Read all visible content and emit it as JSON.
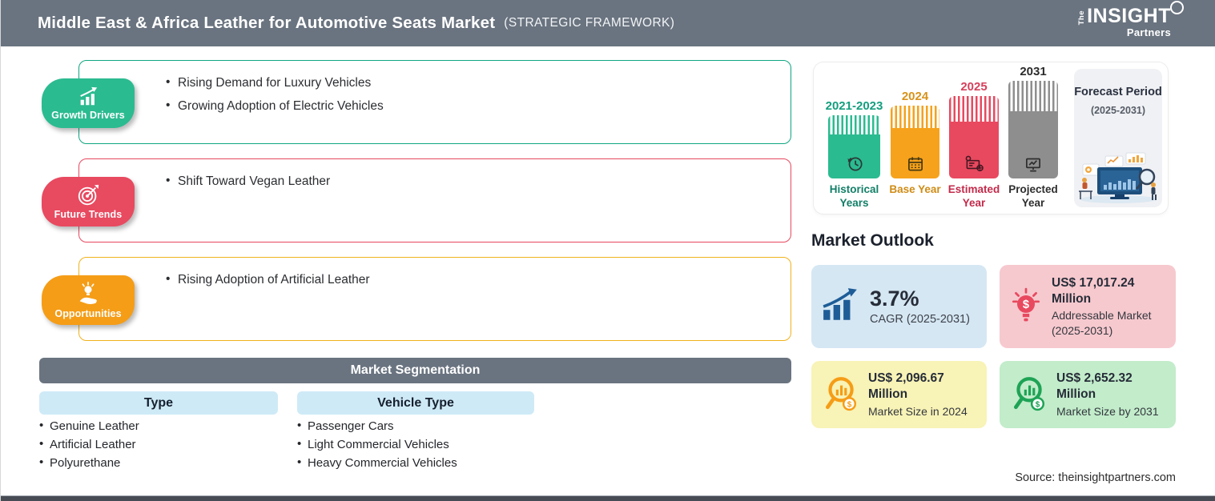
{
  "header": {
    "title": "Middle East & Africa Leather for Automotive Seats Market",
    "framework_tag": "(STRATEGIC FRAMEWORK)",
    "logo": {
      "the": "The",
      "insight": "INSIGHT",
      "partners": "Partners"
    }
  },
  "panels": {
    "growth_drivers": {
      "label": "Growth Drivers",
      "accent_color": "#2bbb90",
      "items": [
        "Rising Demand for Luxury Vehicles",
        "Growing Adoption of Electric Vehicles"
      ]
    },
    "future_trends": {
      "label": "Future Trends",
      "accent_color": "#e84a60",
      "items": [
        "Shift Toward Vegan Leather"
      ]
    },
    "opportunities": {
      "label": "Opportunities",
      "accent_color": "#f59d17",
      "items": [
        "Rising Adoption of Artificial Leather"
      ]
    }
  },
  "segmentation": {
    "title": "Market Segmentation",
    "columns": [
      {
        "header": "Type",
        "items": [
          "Genuine Leather",
          "Artificial Leather",
          "Polyurethane"
        ]
      },
      {
        "header": "Vehicle Type",
        "items": [
          "Passenger Cars",
          "Light Commercial Vehicles",
          "Heavy Commercial Vehicles"
        ]
      }
    ]
  },
  "timeline": {
    "bars": [
      {
        "year": "2021-2023",
        "label": "Historical Years",
        "color": "#2bbb90",
        "icon": "clock-history-icon"
      },
      {
        "year": "2024",
        "label": "Base Year",
        "color": "#f6a21c",
        "icon": "calendar-icon"
      },
      {
        "year": "2025",
        "label": "Estimated Year",
        "color": "#e8495f",
        "icon": "estimate-document-icon"
      },
      {
        "year": "2031",
        "label": "Projected Year",
        "color": "#8e8e8e",
        "icon": "projection-board-icon"
      }
    ],
    "forecast_period": {
      "title": "Forecast Period",
      "range": "(2025-2031)"
    }
  },
  "outlook": {
    "title": "Market Outlook",
    "cards": [
      {
        "value": "3.7%",
        "label": "CAGR (2025-2031)",
        "bg_color": "#d5e7f3",
        "icon": "growth-bars-arrow-icon"
      },
      {
        "value": "US$ 17,017.24 Million",
        "label": "Addressable Market (2025-2031)",
        "bg_color": "#f6c9ce",
        "icon": "bulb-dollar-icon"
      },
      {
        "value": "US$ 2,096.67 Million",
        "label": "Market Size in 2024",
        "bg_color": "#f8f3b6",
        "icon": "magnifier-chart-dollar-icon"
      },
      {
        "value": "US$ 2,652.32 Million",
        "label": "Market Size by 2031",
        "bg_color": "#c2ecca",
        "icon": "magnifier-chart-dollar-icon"
      }
    ]
  },
  "source": "Source: theinsightpartners.com"
}
